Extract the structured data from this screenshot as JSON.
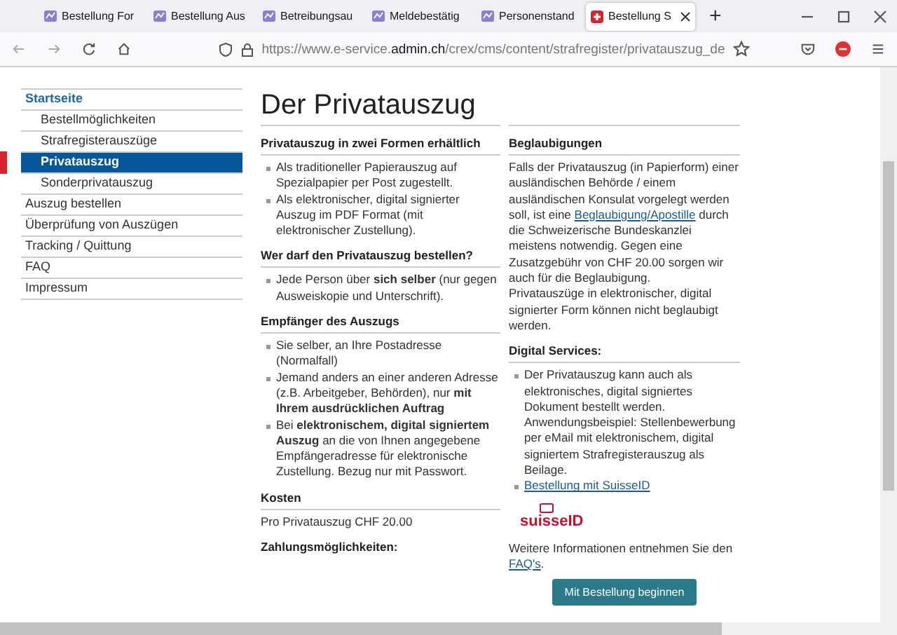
{
  "browser": {
    "tabs": [
      {
        "title": "Bestellung For",
        "selected": false
      },
      {
        "title": "Bestellung Aus",
        "selected": false
      },
      {
        "title": "Betreibungsau",
        "selected": false
      },
      {
        "title": "Meldebestätig",
        "selected": false
      },
      {
        "title": "Personenstand",
        "selected": false
      },
      {
        "title": "Bestellung S",
        "selected": true
      }
    ],
    "new_tab": "+",
    "url": "https://www.e-service.**admin.ch**/crex/cms/content/strafregister/privatauszug_de"
  },
  "sidebar": {
    "items": [
      {
        "label": "Startseite",
        "selected": false,
        "children": [
          {
            "label": "Bestellmöglichkeiten",
            "selected": false
          },
          {
            "label": "Strafregisterauszüge",
            "selected": false
          },
          {
            "label": "Privatauszug",
            "selected": true
          },
          {
            "label": "Sonderprivatauszug",
            "selected": false
          }
        ]
      },
      {
        "label": "Auszug bestellen",
        "selected": false
      },
      {
        "label": "Überprüfung von Auszügen",
        "selected": false
      },
      {
        "label": "Tracking / Quittung",
        "selected": false
      },
      {
        "label": "FAQ",
        "selected": false
      },
      {
        "label": "Impressum",
        "selected": false
      }
    ]
  },
  "title": "Der Privatauszug",
  "left_sections": [
    {
      "heading": "Privatauszug in zwei Formen erhältlich",
      "kind": "list",
      "items": [
        "Als traditioneller Papierauszug auf Spezialpapier per Post zugestellt.",
        "Als elektronischer, digital signierter Auszug im PDF Format (mit elektronischer Zustellung)."
      ]
    },
    {
      "heading": "Wer darf den Privatauszug bestellen?",
      "kind": "list",
      "items": [
        "Jede Person über **sich selber** (nur gegen Ausweiskopie und Unterschrift)."
      ]
    },
    {
      "heading": "Empfänger des Auszugs",
      "kind": "list",
      "items": [
        "Sie selber, an Ihre Postadresse (Normalfall)",
        "Jemand anders an einer anderen Adresse (z.B. Arbeitgeber, Behörden), nur **mit Ihrem ausdrücklichen Auftrag**",
        "Bei **elektronischem, digital signiertem Auszug** an die von Ihnen angegebene Empfängeradresse für elektronische Zustellung. Bezug nur mit Passwort."
      ]
    },
    {
      "heading": "Kosten",
      "kind": "text",
      "text": "Pro Privatauszug CHF 20.00"
    },
    {
      "heading": "Zahlungsmöglichkeiten:",
      "kind": "bare"
    }
  ],
  "certification": {
    "heading": "Beglaubigungen",
    "before": "Falls der Privatauszug (in Papierform) einer ausländischen Behörde / einem ausländischen Konsulat vorgelegt werden soll, ist eine ",
    "link": "Beglaubigung/Apostille",
    "after": " durch die Schweizerische Bundeskanzlei meistens notwendig. Gegen eine Zusatzgebühr von CHF 20.00 sorgen wir auch für die Beglaubigung.",
    "note": "Privatauszüge in elektronischer, digital signierter Form können nicht beglaubigt werden."
  },
  "digital": {
    "heading": "Digital Services:",
    "items": [
      {
        "kind": "text",
        "text": "Der Privatauszug kann auch als elektronisches, digital signiertes Dokument bestellt werden. Anwendungsbeispiel: Stellenbewerbung per eMail mit elektronischem, digital signiertem Strafregisterauszug als Beilage."
      },
      {
        "kind": "link",
        "text": "Bestellung mit SuisseID"
      }
    ],
    "logo": "suisseID"
  },
  "more_info": {
    "before": "Weitere Informationen entnehmen Sie den ",
    "link": "FAQ's",
    "after": "."
  },
  "start_button": "Mit Bestellung beginnen"
}
